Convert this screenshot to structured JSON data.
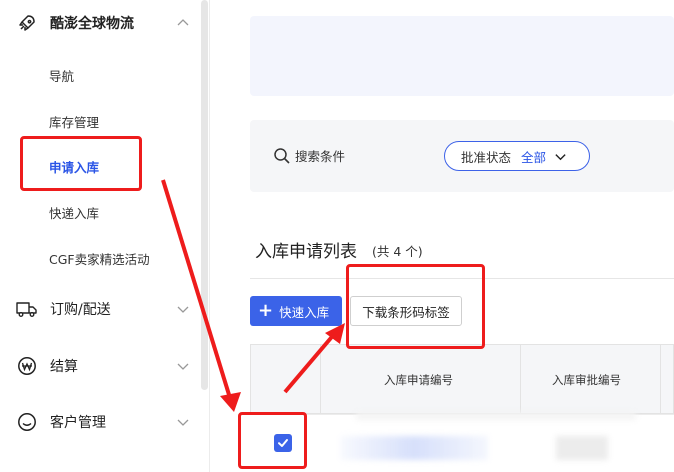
{
  "sidebar": {
    "groups": [
      {
        "label": "酷澎全球物流",
        "icon": "rocket-icon",
        "chevron": "up"
      },
      {
        "label": "订购/配送",
        "icon": "truck-icon",
        "chevron": "down"
      },
      {
        "label": "结算",
        "icon": "won-coin-icon",
        "chevron": "down"
      },
      {
        "label": "客户管理",
        "icon": "smile-icon",
        "chevron": "down"
      }
    ],
    "sub_items": [
      {
        "label": "导航",
        "active": false
      },
      {
        "label": "库存管理",
        "active": false
      },
      {
        "label": "申请入库",
        "active": true
      },
      {
        "label": "快递入库",
        "active": false
      },
      {
        "label": "CGF卖家精选活动",
        "active": false
      }
    ]
  },
  "search": {
    "label": "搜索条件",
    "filter_label": "批准状态",
    "filter_value": "全部"
  },
  "list": {
    "title": "入库申请列表",
    "count": "(共 4 个)",
    "primary_button": "快速入库",
    "outline_button": "下载条形码标签",
    "columns": [
      "入库申请编号",
      "入库审批编号"
    ],
    "row_checked": true
  },
  "colors": {
    "accent": "#3b63e8",
    "active_text": "#2b55e6",
    "annotation": "#ee1c1c"
  }
}
